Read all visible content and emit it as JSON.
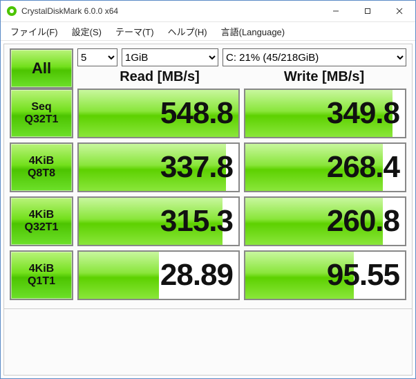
{
  "window": {
    "title": "CrystalDiskMark 6.0.0 x64"
  },
  "menu": {
    "file": "ファイル(F)",
    "settings": "設定(S)",
    "theme": "テーマ(T)",
    "help": "ヘルプ(H)",
    "lang": "言語(Language)"
  },
  "controls": {
    "all_label": "All",
    "runs": "5",
    "size": "1GiB",
    "drive": "C: 21% (45/218GiB)"
  },
  "headers": {
    "read": "Read [MB/s]",
    "write": "Write [MB/s]"
  },
  "tests": [
    {
      "label1": "Seq",
      "label2": "Q32T1",
      "read": "548.8",
      "write": "349.8",
      "read_fill": 100,
      "write_fill": 92
    },
    {
      "label1": "4KiB",
      "label2": "Q8T8",
      "read": "337.8",
      "write": "268.4",
      "read_fill": 92,
      "write_fill": 86
    },
    {
      "label1": "4KiB",
      "label2": "Q32T1",
      "read": "315.3",
      "write": "260.8",
      "read_fill": 90,
      "write_fill": 86
    },
    {
      "label1": "4KiB",
      "label2": "Q1T1",
      "read": "28.89",
      "write": "95.55",
      "read_fill": 50,
      "write_fill": 68
    }
  ]
}
